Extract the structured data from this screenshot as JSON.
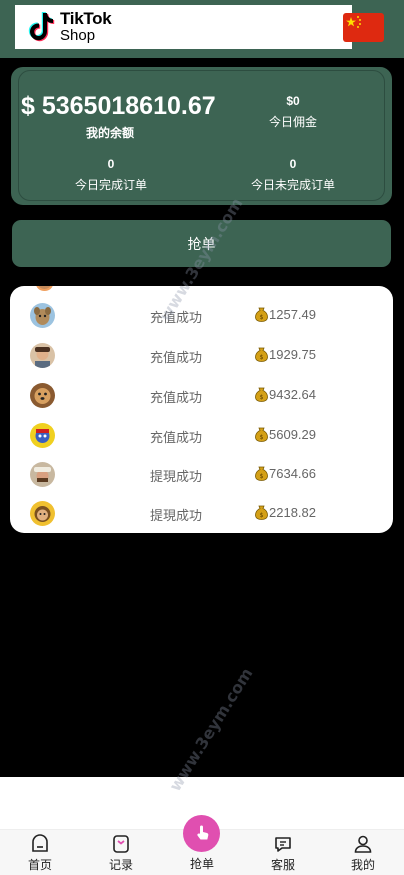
{
  "brand": {
    "line1": "TikTok",
    "line2": "Shop"
  },
  "flag": {
    "name": "china-flag-icon",
    "color": "#de2910"
  },
  "stats": {
    "balance_value": "$ 5365018610.67",
    "balance_label": "我的余额",
    "commission_value": "$0",
    "commission_label": "今日佣金",
    "completed_value": "0",
    "completed_label": "今日完成订单",
    "pending_value": "0",
    "pending_label": "今日未完成订单"
  },
  "grab_button": {
    "label": "抢单"
  },
  "records": [
    {
      "status": "充值成功",
      "amount": "1257.49",
      "avatar": "dog-avatar"
    },
    {
      "status": "充值成功",
      "amount": "1929.75",
      "avatar": "man-avatar"
    },
    {
      "status": "充值成功",
      "amount": "9432.64",
      "avatar": "puppy-avatar"
    },
    {
      "status": "充值成功",
      "amount": "5609.29",
      "avatar": "cartoon-avatar"
    },
    {
      "status": "提現成功",
      "amount": "7634.66",
      "avatar": "hat-avatar"
    },
    {
      "status": "提現成功",
      "amount": "2218.82",
      "avatar": "character-avatar"
    }
  ],
  "nav": {
    "home": "首页",
    "records": "记录",
    "grab": "抢单",
    "service": "客服",
    "mine": "我的"
  },
  "colors": {
    "primary": "#3d6453",
    "accent": "#e04fb0",
    "coin": "#d4a017"
  }
}
